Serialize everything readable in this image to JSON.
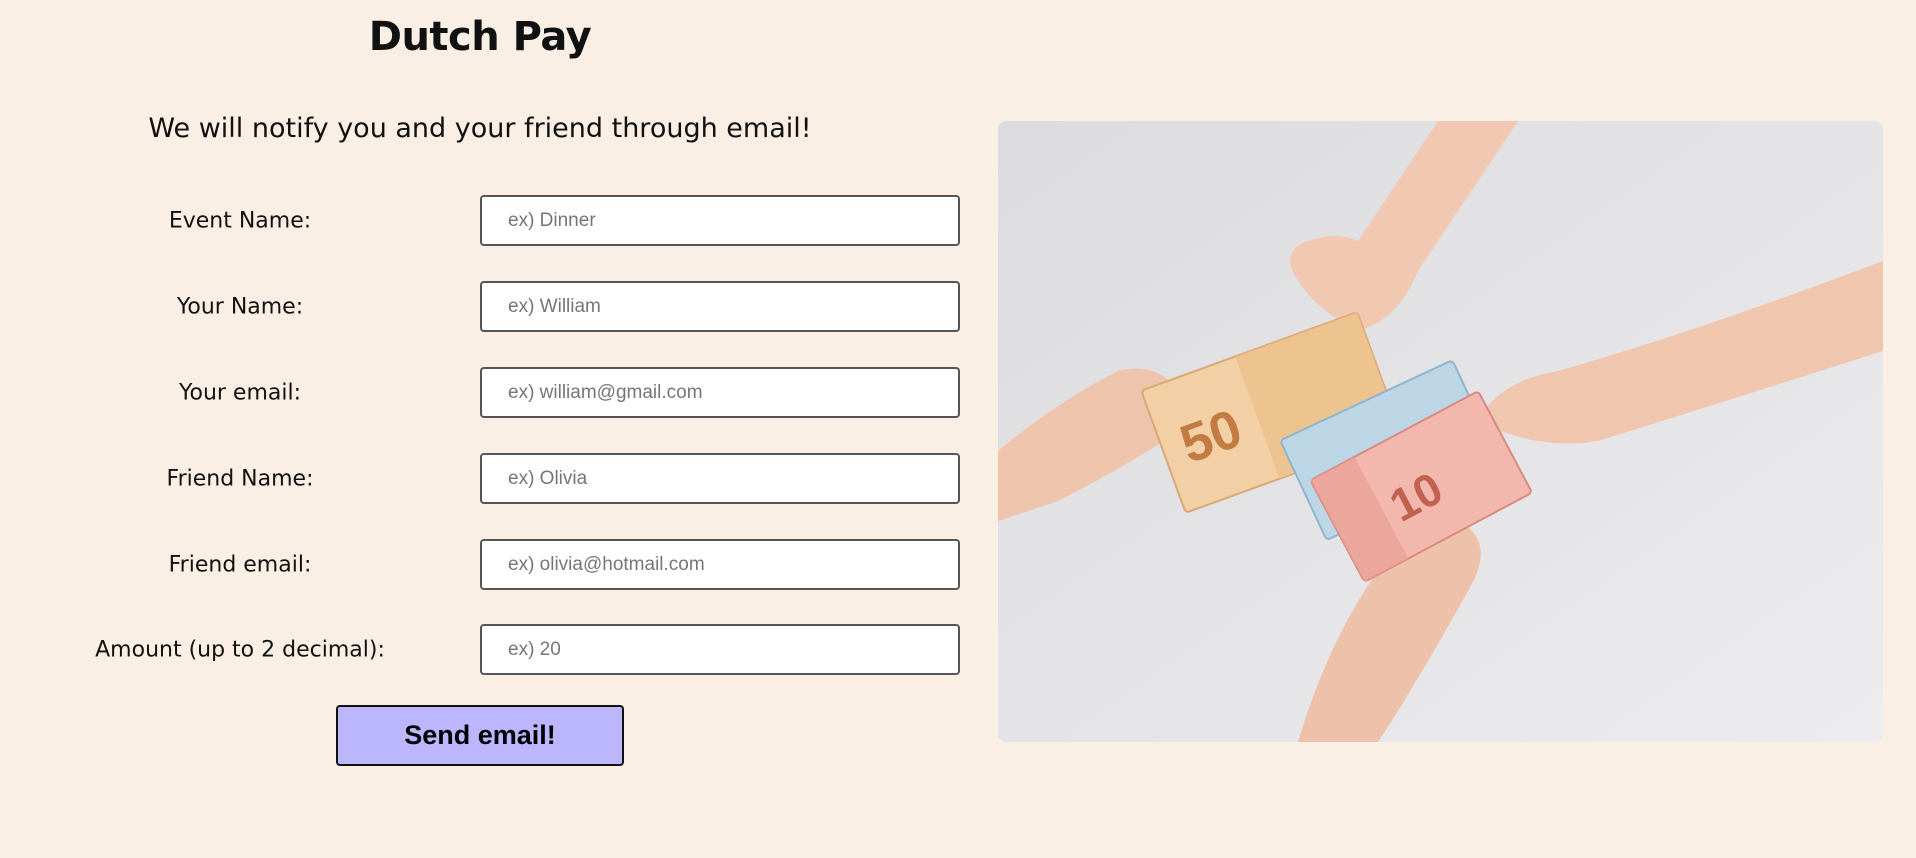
{
  "header": {
    "title": "Dutch Pay",
    "subtitle": "We will notify you and your friend through email!"
  },
  "form": {
    "fields": [
      {
        "label": "Event Name:",
        "placeholder": "ex) Dinner",
        "value": ""
      },
      {
        "label": "Your Name:",
        "placeholder": "ex) William",
        "value": ""
      },
      {
        "label": "Your email:",
        "placeholder": "ex) william@gmail.com",
        "value": ""
      },
      {
        "label": "Friend Name:",
        "placeholder": "ex) Olivia",
        "value": ""
      },
      {
        "label": "Friend email:",
        "placeholder": "ex) olivia@hotmail.com",
        "value": ""
      },
      {
        "label": "Amount (up to 2 decimal):",
        "placeholder": "ex) 20",
        "value": ""
      }
    ],
    "submit_label": "Send email!"
  },
  "image": {
    "banknote_50": "50",
    "banknote_10": "10"
  },
  "colors": {
    "background": "#faefe5",
    "button": "#bcb6ff",
    "input_border": "#555555"
  }
}
